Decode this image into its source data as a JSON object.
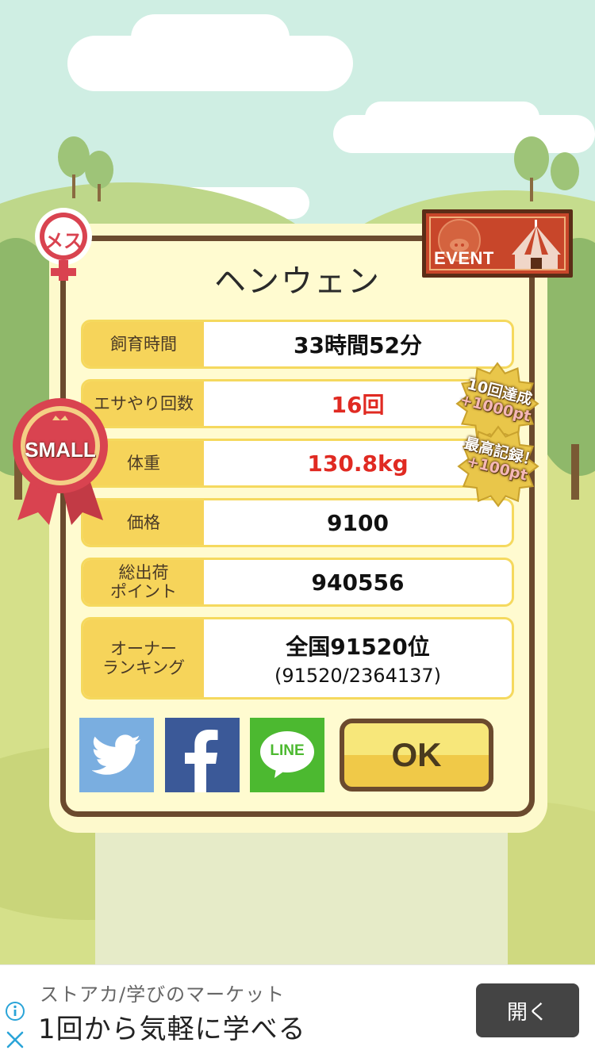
{
  "pet": {
    "name": "ヘンウェン",
    "gender_badge": "メス",
    "size_badge": "SMALL"
  },
  "stats": [
    {
      "label": "飼育時間",
      "value": "33時間52分"
    },
    {
      "label": "エサやり回数",
      "value": "16回"
    },
    {
      "label": "体重",
      "value": "130.8kg"
    },
    {
      "label": "価格",
      "value": "9100"
    },
    {
      "label": "総出荷ポイント",
      "label_line1": "総出荷",
      "label_line2": "ポイント",
      "value": "940556"
    },
    {
      "label": "オーナーランキング",
      "label_line1": "オーナー",
      "label_line2": "ランキング",
      "value": "全国91520位",
      "sub": "(91520/2364137)"
    }
  ],
  "bonuses": [
    {
      "line1": "10回達成",
      "line2": "+1000pt"
    },
    {
      "line1": "最高記録！",
      "line2": "+100pt"
    }
  ],
  "event_badge": "EVENT",
  "share": {
    "twitter_icon": "twitter-bird-icon",
    "facebook_icon": "facebook-f-icon",
    "line_label": "LINE"
  },
  "ok_label": "OK",
  "ad": {
    "source": "ストアカ/学びのマーケット",
    "headline": "1回から気軽に学べる",
    "open_label": "開く"
  },
  "colors": {
    "highlight_red": "#e02a22",
    "label_yellow": "#f6d45a",
    "frame_brown": "#6b4a2e",
    "twitter": "#7aaee0",
    "facebook": "#3b5998",
    "line": "#4cb930"
  }
}
